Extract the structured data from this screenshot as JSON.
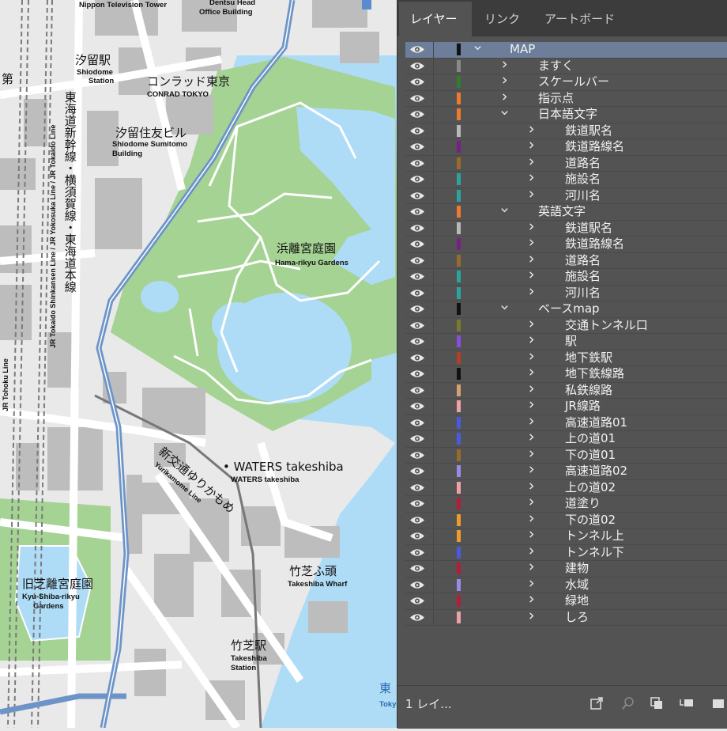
{
  "colors": {
    "water": "#aedcf7",
    "park": "#a5d393",
    "block": "#bdbdbd",
    "road": "#ffffff",
    "ground": "#e9e9e9",
    "expressway": "#6d94c8",
    "panel": "#535353",
    "tabbar": "#3c3c3c",
    "selected_row": "#6c7e9a"
  },
  "map": {
    "labels": {
      "nippon_tv": "Nippon Television Tower",
      "dentsu_1": "Dentsu Head",
      "dentsu_2": "Office Building",
      "shiodome_ja": "汐留駅",
      "shiodome_en_1": "Shiodome",
      "shiodome_en_2": "Station",
      "conrad_ja": "コンラッド東京",
      "conrad_en": "CONRAD TOKYO",
      "sumitomo_ja": "汐留住友ビル",
      "sumitomo_en_1": "Shiodome Sumitomo",
      "sumitomo_en_2": "Building",
      "hamarikyu_ja": "浜離宮庭園",
      "hamarikyu_en": "Hama-rikyu Gardens",
      "waters_ja": "• WATERS takeshiba",
      "waters_en": "WATERS takeshiba",
      "kyushiba_ja": "旧芝離宮庭園",
      "kyushiba_en_1": "Kyu-Shiba-rikyu",
      "kyushiba_en_2": "Gardens",
      "takeshiba_wharf_ja": "竹芝ふ頭",
      "takeshiba_wharf_en": "Takeshiba Wharf",
      "takeshiba_st_ja": "竹芝駅",
      "takeshiba_st_en_1": "Takeshiba",
      "takeshiba_st_en_2": "Station",
      "tokaido_ja": "東海道新幹線・横須賀線・東海道本線",
      "tokaido_en": "JR Tokaido Shinkansen Line / JR Yokosuka Line / JR Tokaido Line",
      "yurikamome_ja": "新交通ゆりかもめ",
      "yurikamome_en": "Yurikamome Line",
      "tohoku_en": "JR Tohoku Line",
      "edge_ja": "第",
      "bottom_ja": "東",
      "bottom_en": "Toky"
    }
  },
  "panel": {
    "tabs": [
      "レイヤー",
      "リンク",
      "アートボード"
    ],
    "layers": [
      {
        "name": "MAP",
        "level": 0,
        "expanded": true,
        "color": "#111111"
      },
      {
        "name": "ますく",
        "level": 1,
        "expanded": false,
        "color": "#8a8a8a"
      },
      {
        "name": "スケールバー",
        "level": 1,
        "expanded": false,
        "color": "#2f7d2f"
      },
      {
        "name": "指示点",
        "level": 1,
        "expanded": false,
        "color": "#ef7a2d"
      },
      {
        "name": "日本語文字",
        "level": 1,
        "expanded": true,
        "color": "#ef7a2d"
      },
      {
        "name": "鉄道駅名",
        "level": 2,
        "expanded": false,
        "color": "#b8b8b8"
      },
      {
        "name": "鉄道路線名",
        "level": 2,
        "expanded": false,
        "color": "#7a1f8a"
      },
      {
        "name": "道路名",
        "level": 2,
        "expanded": false,
        "color": "#9a6a2a"
      },
      {
        "name": "施設名",
        "level": 2,
        "expanded": false,
        "color": "#2aa3a3"
      },
      {
        "name": "河川名",
        "level": 2,
        "expanded": false,
        "color": "#2aa3a3"
      },
      {
        "name": "英語文字",
        "level": 1,
        "expanded": true,
        "color": "#ef7a2d"
      },
      {
        "name": "鉄道駅名",
        "level": 2,
        "expanded": false,
        "color": "#b8b8b8"
      },
      {
        "name": "鉄道路線名",
        "level": 2,
        "expanded": false,
        "color": "#7a1f8a"
      },
      {
        "name": "道路名",
        "level": 2,
        "expanded": false,
        "color": "#9a6a2a"
      },
      {
        "name": "施設名",
        "level": 2,
        "expanded": false,
        "color": "#2aa3a3"
      },
      {
        "name": "河川名",
        "level": 2,
        "expanded": false,
        "color": "#2aa3a3"
      },
      {
        "name": "ベースmap",
        "level": 1,
        "expanded": true,
        "color": "#111111"
      },
      {
        "name": "交通トンネル口",
        "level": 2,
        "expanded": false,
        "color": "#7a7a2a"
      },
      {
        "name": "駅",
        "level": 2,
        "expanded": false,
        "color": "#8a4de0"
      },
      {
        "name": "地下鉄駅",
        "level": 2,
        "expanded": false,
        "color": "#b0402a"
      },
      {
        "name": "地下鉄線路",
        "level": 2,
        "expanded": false,
        "color": "#111111"
      },
      {
        "name": "私鉄線路",
        "level": 2,
        "expanded": false,
        "color": "#d6a070"
      },
      {
        "name": "JR線路",
        "level": 2,
        "expanded": false,
        "color": "#f0a0a8"
      },
      {
        "name": "高速道路01",
        "level": 2,
        "expanded": false,
        "color": "#4a5ae0"
      },
      {
        "name": "上の道01",
        "level": 2,
        "expanded": false,
        "color": "#4a5ae0"
      },
      {
        "name": "下の道01",
        "level": 2,
        "expanded": false,
        "color": "#9a6a2a"
      },
      {
        "name": "高速道路02",
        "level": 2,
        "expanded": false,
        "color": "#9a8ae8"
      },
      {
        "name": "上の道02",
        "level": 2,
        "expanded": false,
        "color": "#f0a0a8"
      },
      {
        "name": "道塗り",
        "level": 2,
        "expanded": false,
        "color": "#b0203a"
      },
      {
        "name": "下の道02",
        "level": 2,
        "expanded": false,
        "color": "#ef9a2d"
      },
      {
        "name": "トンネル上",
        "level": 2,
        "expanded": false,
        "color": "#ef9a2d"
      },
      {
        "name": "トンネル下",
        "level": 2,
        "expanded": false,
        "color": "#4a5ae0"
      },
      {
        "name": "建物",
        "level": 2,
        "expanded": false,
        "color": "#b0203a"
      },
      {
        "name": "水域",
        "level": 2,
        "expanded": false,
        "color": "#9a8ae8"
      },
      {
        "name": "緑地",
        "level": 2,
        "expanded": false,
        "color": "#b0203a"
      },
      {
        "name": "しろ",
        "level": 2,
        "expanded": false,
        "color": "#f0a0a8"
      }
    ],
    "footer": {
      "layer_count": "1 レイ..."
    }
  }
}
